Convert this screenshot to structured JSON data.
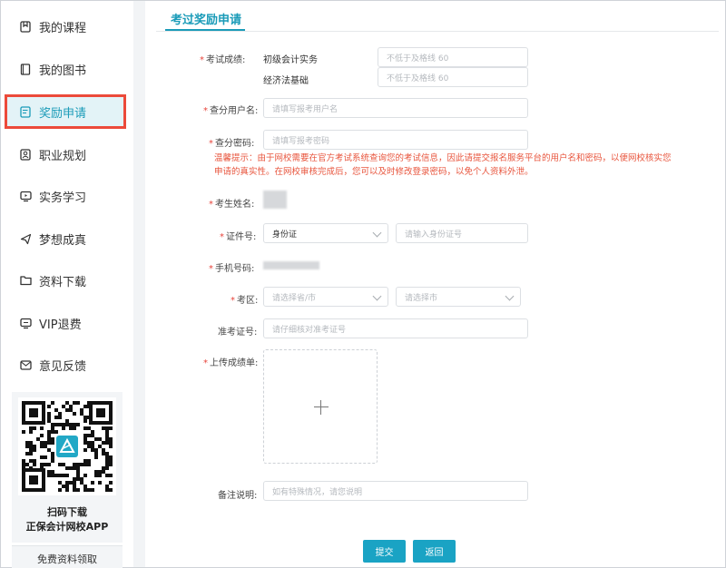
{
  "sidebar": {
    "items": [
      {
        "label": "我的课程",
        "icon": "bookmark-icon"
      },
      {
        "label": "我的图书",
        "icon": "book-icon"
      },
      {
        "label": "奖励申请",
        "icon": "form-icon"
      },
      {
        "label": "职业规划",
        "icon": "badge-icon"
      },
      {
        "label": "实务学习",
        "icon": "monitor-icon"
      },
      {
        "label": "梦想成真",
        "icon": "paper-plane-icon"
      },
      {
        "label": "资料下载",
        "icon": "folder-icon"
      },
      {
        "label": "VIP退费",
        "icon": "screen-icon"
      },
      {
        "label": "意见反馈",
        "icon": "mail-icon"
      }
    ],
    "qr_line1": "扫码下载",
    "qr_line2": "正保会计网校APP",
    "free_link": "免费资料领取"
  },
  "main": {
    "tab_title": "考过奖励申请",
    "form": {
      "score_label": "考试成绩:",
      "subject1": "初级会计实务",
      "subject1_placeholder": "不低于及格线 60",
      "subject2": "经济法基础",
      "subject2_placeholder": "不低于及格线 60",
      "query_user_label": "查分用户名:",
      "query_user_placeholder": "请填写报考用户名",
      "query_pwd_label": "查分密码:",
      "query_pwd_placeholder": "请填写报考密码",
      "tip": "温馨提示：由于网校需要在官方考试系统查询您的考试信息，因此请提交报名服务平台的用户名和密码，以便网校核实您申请的真实性。在网校审核完成后，您可以及时修改登录密码，以免个人资料外泄。",
      "name_label": "考生姓名:",
      "id_label": "证件号:",
      "id_type": "身份证",
      "id_placeholder": "请输入身份证号",
      "phone_label": "手机号码:",
      "area_label": "考区:",
      "province_placeholder": "请选择省/市",
      "city_placeholder": "请选择市",
      "ticket_label": "准考证号:",
      "ticket_placeholder": "请仔细核对准考证号",
      "upload_label": "上传成绩单:",
      "remark_label": "备注说明:",
      "remark_placeholder": "如有特殊情况，请您说明"
    },
    "submit_label": "提交",
    "back_label": "返回"
  },
  "colors": {
    "accent": "#1a9bb8",
    "button": "#1aa3c4",
    "warning": "#e8553d",
    "highlight": "#ec4a3a"
  }
}
